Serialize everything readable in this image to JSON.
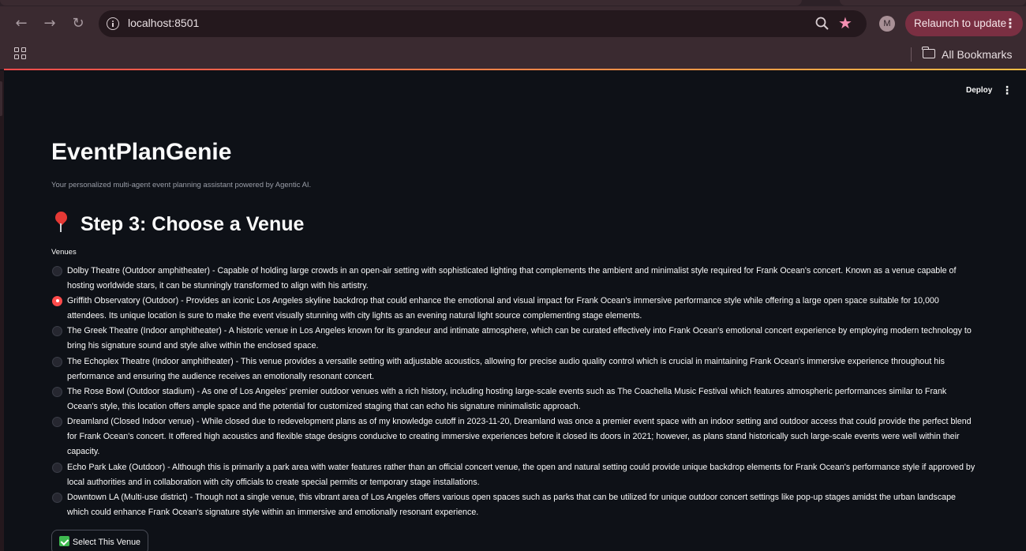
{
  "browser": {
    "url": "localhost:8501",
    "relaunch_label": "Relaunch to update",
    "profile_initial": "M",
    "bookmarks_label": "All Bookmarks"
  },
  "app": {
    "deploy_label": "Deploy",
    "title": "EventPlanGenie",
    "subtitle": "Your personalized multi-agent event planning assistant powered by Agentic AI.",
    "step_title": "Step 3: Choose a Venue",
    "venues_label": "Venues",
    "selected_index": 1,
    "venues": [
      "Dolby Theatre (Outdoor amphitheater) - Capable of holding large crowds in an open-air setting with sophisticated lighting that complements the ambient and minimalist style required for Frank Ocean's concert. Known as a venue capable of hosting worldwide stars, it can be stunningly transformed to align with his artistry.",
      "Griffith Observatory (Outdoor) - Provides an iconic Los Angeles skyline backdrop that could enhance the emotional and visual impact for Frank Ocean's immersive performance style while offering a large open space suitable for 10,000 attendees. Its unique location is sure to make the event visually stunning with city lights as an evening natural light source complementing stage elements.",
      "The Greek Theatre (Indoor amphitheater) - A historic venue in Los Angeles known for its grandeur and intimate atmosphere, which can be curated effectively into Frank Ocean's emotional concert experience by employing modern technology to bring his signature sound and style alive within the enclosed space.",
      "The Echoplex Theatre (Indoor amphitheater) - This venue provides a versatile setting with adjustable acoustics, allowing for precise audio quality control which is crucial in maintaining Frank Ocean's immersive experience throughout his performance and ensuring the audience receives an emotionally resonant concert.",
      "The Rose Bowl (Outdoor stadium) - As one of Los Angeles' premier outdoor venues with a rich history, including hosting large-scale events such as The Coachella Music Festival which features atmospheric performances similar to Frank Ocean's style, this location offers ample space and the potential for customized staging that can echo his signature minimalistic approach.",
      "Dreamland (Closed Indoor venue) - While closed due to redevelopment plans as of my knowledge cutoff in 2023-11-20, Dreamland was once a premier event space with an indoor setting and outdoor access that could provide the perfect blend for Frank Ocean's concert. It offered high acoustics and flexible stage designs conducive to creating immersive experiences before it closed its doors in 2021; however, as plans stand historically such large-scale events were well within their capacity.",
      "Echo Park Lake (Outdoor) - Although this is primarily a park area with water features rather than an official concert venue, the open and natural setting could provide unique backdrop elements for Frank Ocean's performance style if approved by local authorities and in collaboration with city officials to create special permits or temporary stage installations.",
      "Downtown LA (Multi-use district) - Though not a single venue, this vibrant area of Los Angeles offers various open spaces such as parks that can be utilized for unique outdoor concert settings like pop-up stages amidst the urban landscape which could enhance Frank Ocean's signature style within an immersive and emotionally resonant experience."
    ],
    "select_button_label": "Select This Venue"
  }
}
